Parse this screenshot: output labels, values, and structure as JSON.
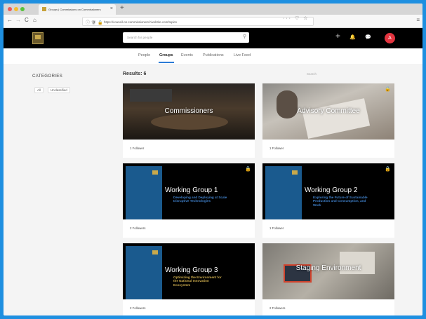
{
  "browser": {
    "tab_title": "Groups | Commissions on Commissioners",
    "tab_close": "×",
    "new_tab": "+",
    "url": "https://council-on-commissioners.hivebrite.com/topics",
    "back": "←",
    "forward": "→",
    "reload": "C",
    "home": "⌂",
    "url_icons": "ⓘ 🛡",
    "lock": "🔒",
    "page_actions": "··· ♡ ☆",
    "menu": "≡"
  },
  "header": {
    "search_placeholder": "Search for people",
    "search_icon": "⚲",
    "add_icon": "+",
    "bell_icon": "🔔",
    "chat_icon": "💬",
    "avatar_initial": "A"
  },
  "nav": {
    "tabs": [
      "People",
      "Groups",
      "Events",
      "Publications",
      "Live Feed"
    ],
    "active": "Groups"
  },
  "sidebar": {
    "title": "CATEGORIES",
    "chips": [
      "All",
      "Unclassified"
    ]
  },
  "main": {
    "results_label": "Results: 6",
    "sort_placeholder": "Search"
  },
  "groups": [
    {
      "title": "Commissioners",
      "subtitle": "",
      "followers": "1 Follower",
      "style": "boardroom"
    },
    {
      "title": "Advisory Committee",
      "subtitle": "",
      "followers": "1 Follower",
      "style": "meeting"
    },
    {
      "title": "Working Group 1",
      "subtitle": "Developing and Deploying at Scale Disruptive Technologies",
      "followers": "2 Followers",
      "style": "doc"
    },
    {
      "title": "Working Group 2",
      "subtitle": "Exploring the Future of Sustainable Production and Consumption, and Work",
      "followers": "1 Follower",
      "style": "doc"
    },
    {
      "title": "Working Group 3",
      "subtitle": "Optimizing the Environment for the National Innovation Ecosystem",
      "followers": "2 Followers",
      "style": "doc"
    },
    {
      "title": "Staging Environment",
      "subtitle": "",
      "followers": "2 Followers",
      "style": "desk"
    }
  ],
  "colors": {
    "accent": "#2b7bd6",
    "avatar": "#e3343f",
    "subtitle_blue": "#3f7fc8",
    "subtitle_gold": "#c9a94b"
  }
}
